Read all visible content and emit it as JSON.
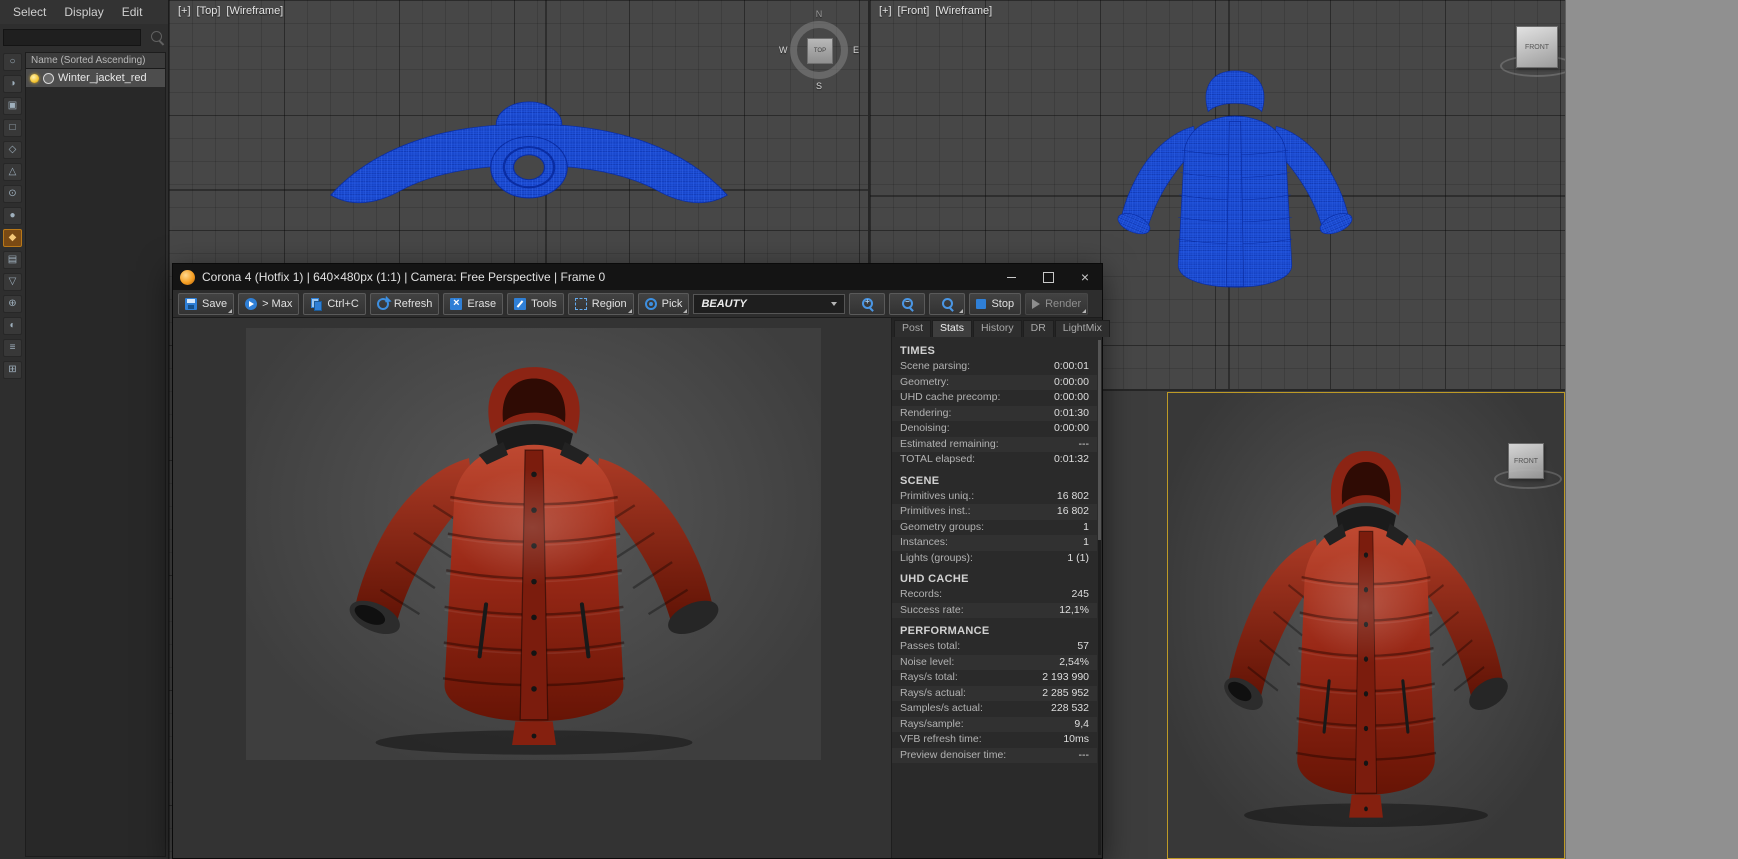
{
  "explorer": {
    "menu": [
      {
        "label": "Select"
      },
      {
        "label": "Display"
      },
      {
        "label": "Edit"
      }
    ],
    "search": {
      "value": "",
      "placeholder": ""
    },
    "column_header": "Name (Sorted Ascending)",
    "rows": [
      {
        "label": "Winter_jacket_red"
      }
    ],
    "toolbar_icons": [
      {
        "name": "filter-all-icon",
        "glyph": "○"
      },
      {
        "name": "filter-geometry-icon",
        "glyph": "◑"
      },
      {
        "name": "filter-shapes-icon",
        "glyph": "▣"
      },
      {
        "name": "filter-lights-icon",
        "glyph": "□"
      },
      {
        "name": "filter-cameras-icon",
        "glyph": "◇"
      },
      {
        "name": "filter-helpers-icon",
        "glyph": "△"
      },
      {
        "name": "filter-spacewarps-icon",
        "glyph": "⊙"
      },
      {
        "name": "filter-groups-icon",
        "glyph": "●"
      },
      {
        "name": "filter-materials-icon",
        "glyph": "◆",
        "active": true
      },
      {
        "name": "filter-xrefs-icon",
        "glyph": "▤"
      },
      {
        "name": "filter-bones-icon",
        "glyph": "▽"
      },
      {
        "name": "filter-containers-icon",
        "glyph": "⊕"
      },
      {
        "name": "filter-frozen-icon",
        "glyph": "◐"
      },
      {
        "name": "filter-layers-icon",
        "glyph": "≡"
      },
      {
        "name": "filter-selection-sets-icon",
        "glyph": "⊞"
      }
    ]
  },
  "viewports": {
    "top": {
      "nav": "[+]",
      "name": "[Top]",
      "shading": "[Wireframe]",
      "compass": {
        "north": "N",
        "east": "E",
        "south": "S",
        "west": "W",
        "center": "TOP"
      }
    },
    "front": {
      "nav": "[+]",
      "name": "[Front]",
      "shading": "[Wireframe]",
      "viewcube_label": "FRONT"
    },
    "camera": {
      "viewcube_label": "FRONT"
    }
  },
  "vfb": {
    "title": "Corona 4 (Hotfix 1) | 640×480px (1:1) | Camera: Free Perspective | Frame 0",
    "toolbar": {
      "save": "Save",
      "to_max": "> Max",
      "copy": "Ctrl+C",
      "refresh": "Refresh",
      "erase": "Erase",
      "tools": "Tools",
      "region": "Region",
      "pick": "Pick",
      "channel": "BEAUTY",
      "stop": "Stop",
      "render": "Render"
    },
    "tabs": [
      {
        "label": "Post"
      },
      {
        "label": "Stats",
        "active": true
      },
      {
        "label": "History"
      },
      {
        "label": "DR"
      },
      {
        "label": "LightMix"
      }
    ],
    "stats_sections": [
      {
        "title": "TIMES",
        "rows": [
          {
            "label": "Scene parsing:",
            "value": "0:00:01"
          },
          {
            "label": "Geometry:",
            "value": "0:00:00"
          },
          {
            "label": "UHD cache precomp:",
            "value": "0:00:00"
          },
          {
            "label": "Rendering:",
            "value": "0:01:30"
          },
          {
            "label": "Denoising:",
            "value": "0:00:00"
          },
          {
            "label": "Estimated remaining:",
            "value": "---"
          },
          {
            "label": "TOTAL elapsed:",
            "value": "0:01:32"
          }
        ]
      },
      {
        "title": "SCENE",
        "rows": [
          {
            "label": "Primitives uniq.:",
            "value": "16 802"
          },
          {
            "label": "Primitives inst.:",
            "value": "16 802"
          },
          {
            "label": "Geometry groups:",
            "value": "1"
          },
          {
            "label": "Instances:",
            "value": "1"
          },
          {
            "label": "Lights (groups):",
            "value": "1 (1)"
          }
        ]
      },
      {
        "title": "UHD CACHE",
        "rows": [
          {
            "label": "Records:",
            "value": "245"
          },
          {
            "label": "Success rate:",
            "value": "12,1%"
          }
        ]
      },
      {
        "title": "PERFORMANCE",
        "rows": [
          {
            "label": "Passes total:",
            "value": "57"
          },
          {
            "label": "Noise level:",
            "value": "2,54%"
          },
          {
            "label": "Rays/s total:",
            "value": "2 193 990"
          },
          {
            "label": "Rays/s actual:",
            "value": "2 285 952"
          },
          {
            "label": "Samples/s actual:",
            "value": "228 532"
          },
          {
            "label": "Rays/sample:",
            "value": "9,4"
          },
          {
            "label": "VFB refresh time:",
            "value": "10ms"
          },
          {
            "label": "Preview denoiser time:",
            "value": "---"
          }
        ]
      }
    ]
  },
  "colors": {
    "accent_blue": "#3d8fe0",
    "wireframe_blue": "#1b4cd4",
    "active_viewport_border": "#bd9a26",
    "corona_orange": "#f59f24",
    "jacket_red": "#9a2917"
  }
}
